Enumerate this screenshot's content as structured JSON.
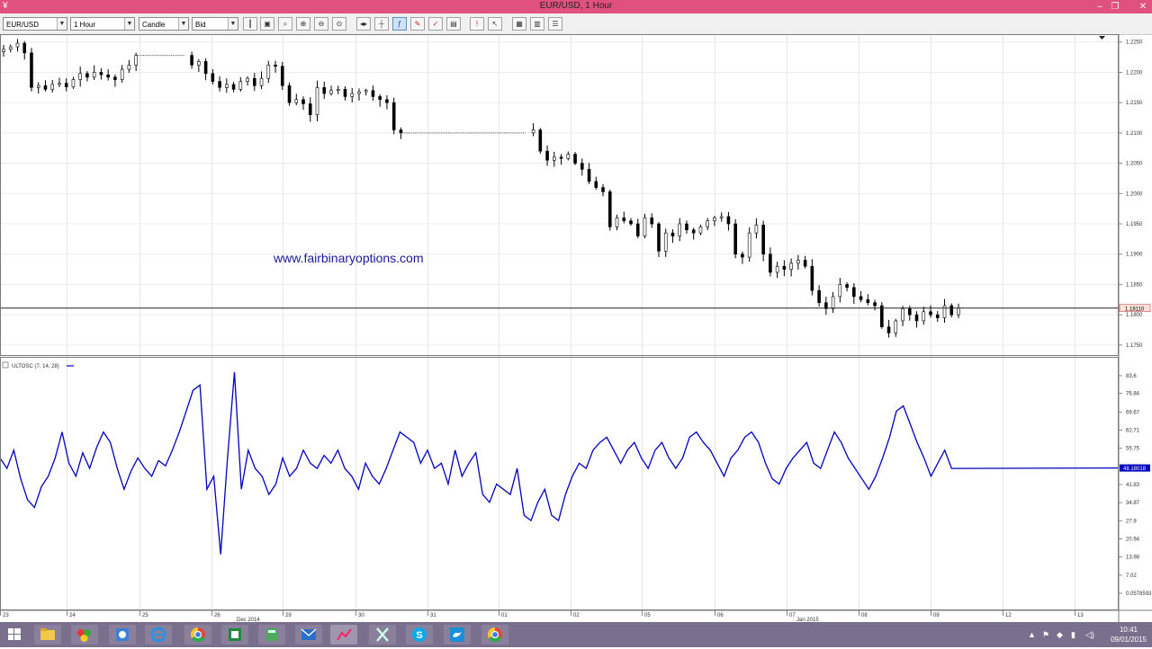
{
  "window": {
    "title": "EUR/USD,  1 Hour",
    "minimize": "‒",
    "restore": "❐",
    "close": "✕"
  },
  "toolbar": {
    "symbol": "EUR/USD",
    "period": "1 Hour",
    "chart_type": "Candle",
    "price_type": "Bid"
  },
  "watermark": "www.fairbinaryoptions.com",
  "chart_data": [
    {
      "type": "candlestick",
      "name": "EUR/USD",
      "period": "1 Hour",
      "price_ticks": [
        "1.2250",
        "1.2200",
        "1.2150",
        "1.2100",
        "1.2050",
        "1.2000",
        "1.1950",
        "1.1900",
        "1.1850",
        "1.1800",
        "1.1750"
      ],
      "ylim": [
        1.1735,
        1.226
      ],
      "current_price": "1.18110",
      "current_value": 1.1811,
      "close_path": [
        1.2238,
        1.2242,
        1.2248,
        1.2232,
        1.2175,
        1.2178,
        1.2172,
        1.218,
        1.2182,
        1.2176,
        1.2188,
        1.2198,
        1.2192,
        1.22,
        1.2196,
        1.2192,
        1.2188,
        1.2205,
        1.2212,
        1.2228,
        1.2228,
        1.2228,
        1.2228,
        1.2228,
        1.2228,
        1.2228,
        1.2228,
        1.2212,
        1.2218,
        1.2198,
        1.2185,
        1.2175,
        1.218,
        1.2172,
        1.2185,
        1.219,
        1.2178,
        1.219,
        1.2212,
        1.221,
        1.2178,
        1.215,
        1.2155,
        1.2148,
        1.213,
        1.2175,
        1.2165,
        1.217,
        1.2172,
        1.216,
        1.2165,
        1.2168,
        1.217,
        1.216,
        1.2155,
        1.215,
        1.2105,
        1.21,
        1.21,
        1.21,
        1.21,
        1.21,
        1.21,
        1.21,
        1.21,
        1.21,
        1.21,
        1.21,
        1.21,
        1.21,
        1.21,
        1.21,
        1.21,
        1.21,
        1.21,
        1.21,
        1.2105,
        1.207,
        1.2055,
        1.206,
        1.2058,
        1.2065,
        1.205,
        1.204,
        1.202,
        1.201,
        1.2003,
        1.1945,
        1.196,
        1.1955,
        1.195,
        1.193,
        1.196,
        1.195,
        1.1905,
        1.1935,
        1.193,
        1.195,
        1.194,
        1.1935,
        1.1945,
        1.1955,
        1.196,
        1.1962,
        1.195,
        1.19,
        1.1895,
        1.1935,
        1.1948,
        1.19,
        1.187,
        1.188,
        1.1875,
        1.1885,
        1.189,
        1.188,
        1.184,
        1.182,
        1.181,
        1.183,
        1.185,
        1.1845,
        1.183,
        1.1825,
        1.182,
        1.1815,
        1.178,
        1.177,
        1.179,
        1.181,
        1.18,
        1.179,
        1.1805,
        1.18,
        1.1795,
        1.1815,
        1.18,
        1.1811
      ],
      "date_labels": [
        "23",
        "24",
        "25",
        "26",
        "29",
        "30",
        "31",
        "01",
        "02",
        "05",
        "06",
        "07",
        "08",
        "09",
        "12",
        "13"
      ],
      "month_labels": [
        "Dec 2014",
        "Jan 2015"
      ]
    },
    {
      "type": "line",
      "name": "ULTOSC",
      "legend": "ULTOSC (7, 14, 28)",
      "color": "#0000c0",
      "ticks": [
        "83.6",
        "76.84",
        "69.67",
        "62.71",
        "55.75",
        "48.79",
        "41.83",
        "34.87",
        "27.9",
        "20.94",
        "13.98",
        "7.02",
        "0.0578593"
      ],
      "ylim": [
        0.0578593,
        83.6
      ],
      "current_value": "48.18018",
      "series": [
        52,
        48,
        55,
        44,
        36,
        33,
        41,
        45,
        52,
        62,
        50,
        45,
        54,
        48,
        56,
        62,
        58,
        48,
        40,
        47,
        52,
        48,
        45,
        51,
        49,
        55,
        62,
        70,
        78,
        80,
        40,
        45,
        15,
        52,
        85,
        40,
        55,
        48,
        45,
        38,
        42,
        52,
        45,
        48,
        55,
        50,
        48,
        53,
        50,
        55,
        48,
        45,
        40,
        50,
        45,
        42,
        48,
        55,
        62,
        60,
        58,
        50,
        55,
        48,
        50,
        42,
        55,
        45,
        50,
        54,
        38,
        35,
        42,
        40,
        38,
        48,
        30,
        28,
        35,
        40,
        30,
        28,
        38,
        45,
        50,
        48,
        55,
        58,
        60,
        55,
        50,
        55,
        58,
        52,
        48,
        55,
        58,
        52,
        48,
        52,
        60,
        62,
        58,
        55,
        50,
        45,
        52,
        55,
        60,
        62,
        58,
        50,
        44,
        42,
        48,
        52,
        55,
        58,
        50,
        48,
        55,
        62,
        58,
        52,
        48,
        44,
        40,
        45,
        52,
        60,
        70,
        72,
        65,
        58,
        52,
        45,
        50,
        55,
        48,
        48
      ]
    }
  ],
  "taskbar": {
    "clock_time": "10:41",
    "clock_date": "09/01/2015"
  }
}
